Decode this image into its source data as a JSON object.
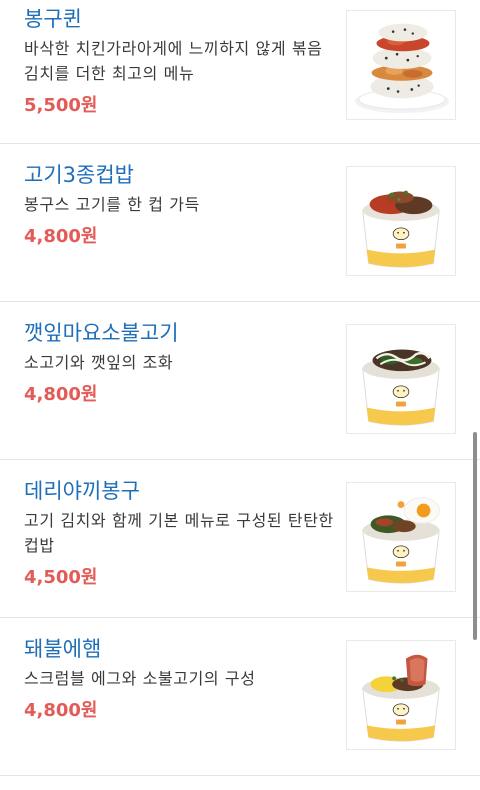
{
  "menu": {
    "items": [
      {
        "name": "봉구퀸",
        "description": "바삭한 치킨가라아게에 느끼하지 않게 볶음 김치를 더한 최고의 메뉴",
        "price": "5,500원",
        "image_icon": "chicken-rice-ball-icon"
      },
      {
        "name": "고기3종컵밥",
        "description": "봉구스 고기를 한 컵 가득",
        "price": "4,800원",
        "image_icon": "cup-rice-bowl-icon"
      },
      {
        "name": "깻잎마요소불고기",
        "description": "소고기와 깻잎의 조화",
        "price": "4,800원",
        "image_icon": "cup-rice-bowl-icon"
      },
      {
        "name": "데리야끼봉구",
        "description": "고기 김치와 함께 기본 메뉴로 구성된 탄탄한 컵밥",
        "price": "4,500원",
        "image_icon": "cup-rice-bowl-icon"
      },
      {
        "name": "돼불에햄",
        "description": "스크럼블 에그와 소불고기의 구성",
        "price": "4,800원",
        "image_icon": "cup-rice-bowl-icon"
      }
    ]
  },
  "colors": {
    "name": "#1f6fb8",
    "price": "#e35b57",
    "text": "#3a3a3a",
    "divider": "#e4e4e4"
  }
}
